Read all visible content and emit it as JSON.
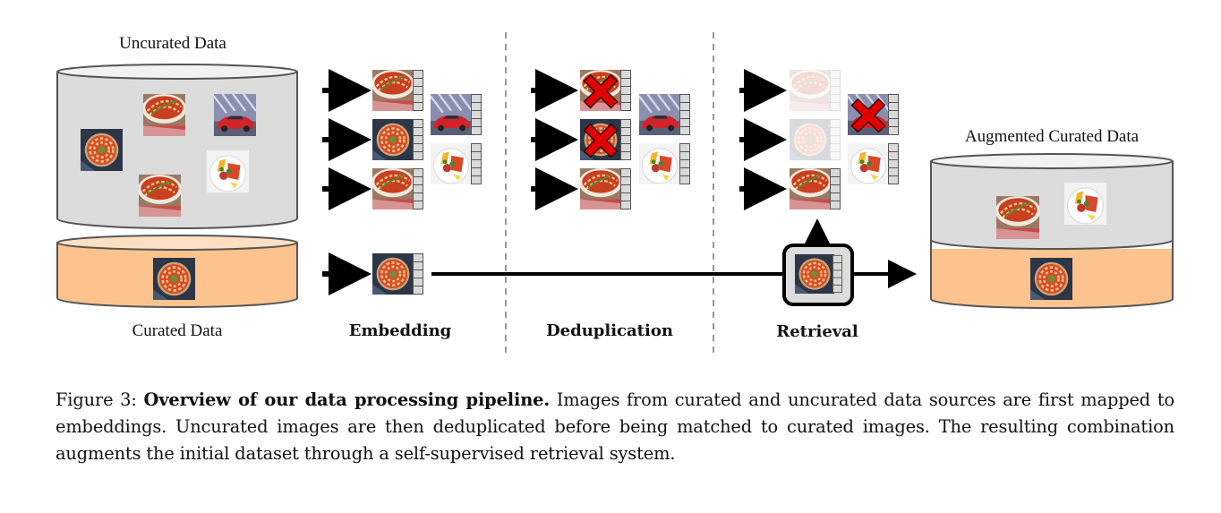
{
  "figure": {
    "labels": {
      "uncurated": "Uncurated Data",
      "curated": "Curated Data",
      "augmented": "Augmented Curated Data"
    },
    "stages": [
      "Embedding",
      "Deduplication",
      "Retrieval"
    ],
    "colors": {
      "uncurated_fill": "#dcdcdc",
      "uncurated_top": "#f2f2f2",
      "curated_fill": "#fcc38f",
      "curated_top": "#fde0c4",
      "outline": "#555555",
      "arrow": "#000000",
      "cross": "#e00000",
      "embedding_cell": "#d9d9d9"
    },
    "images": {
      "ratatouille_dish": "ratatouille-dish-image",
      "ratatouille_round": "ratatouille-round-image",
      "sports_car": "sports-car-image",
      "plated_food": "plated-food-image"
    },
    "embedding_stage": {
      "rows": [
        "ratatouille_dish",
        "ratatouille_round",
        "ratatouille_dish"
      ],
      "extras": [
        "sports_car",
        "plated_food"
      ]
    },
    "dedup_stage": {
      "rows": [
        {
          "image": "ratatouille_dish",
          "removed": true
        },
        {
          "image": "ratatouille_round",
          "removed": true
        },
        {
          "image": "ratatouille_dish",
          "removed": false
        }
      ],
      "extras": [
        {
          "image": "sports_car",
          "removed": false
        },
        {
          "image": "plated_food",
          "removed": false
        }
      ]
    },
    "retrieval_stage": {
      "rows": [
        {
          "image": "ratatouille_dish",
          "faded": true
        },
        {
          "image": "ratatouille_round",
          "faded": true
        },
        {
          "image": "ratatouille_dish",
          "faded": false
        }
      ],
      "extras": [
        {
          "image": "sports_car",
          "removed": true
        },
        {
          "image": "plated_food",
          "removed": false
        }
      ]
    }
  },
  "caption": {
    "prefix": "Figure 3: ",
    "title": "Overview of our data processing pipeline.",
    "body": " Images from curated and uncurated data sources are first mapped to embeddings. Uncurated images are then deduplicated before being matched to curated images. The resulting combination augments the initial dataset through a self-supervised retrieval system."
  }
}
